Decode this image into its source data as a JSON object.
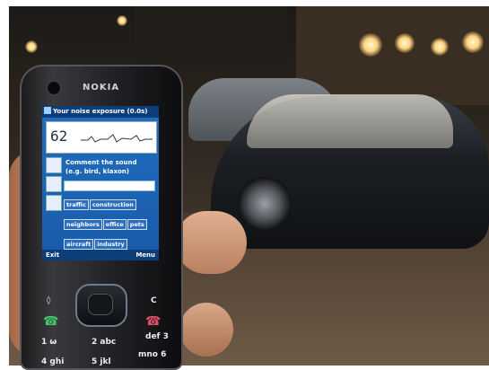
{
  "phone": {
    "brand": "NOKIA",
    "screen": {
      "title": "Your noise exposure (0.0s)",
      "db_value": "62",
      "prompt_line1": "Comment the sound",
      "prompt_line2": "(e.g. bird, klaxon)",
      "input_value": "",
      "tags": [
        "traffic",
        "construction",
        "neighbors",
        "office",
        "pets",
        "aircraft",
        "industry"
      ],
      "left_softkey": "Exit",
      "right_softkey": "Menu"
    },
    "keypad": {
      "k1": "1 ω",
      "k2": "2 abc",
      "k3": "def 3",
      "k4": "4 ghi",
      "k5": "5 jkl",
      "k6": "mno 6",
      "c_key": "C"
    }
  }
}
